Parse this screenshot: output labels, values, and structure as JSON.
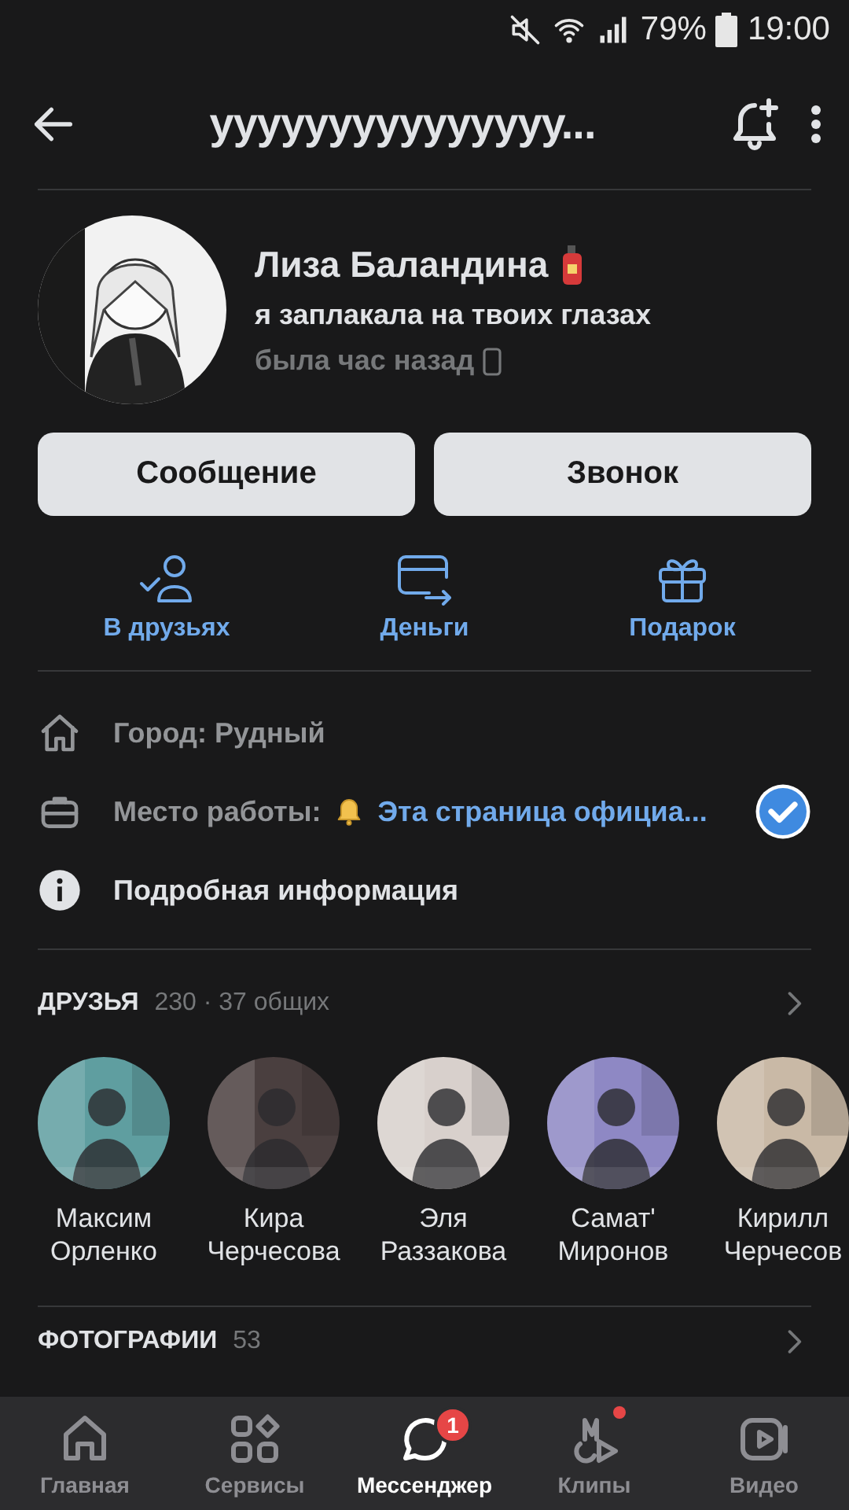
{
  "status_bar": {
    "battery": "79%",
    "time": "19:00"
  },
  "header": {
    "title": "ууууууууууууууу..."
  },
  "profile": {
    "name": "Лиза Баландина",
    "status": "я заплакала на твоих глазах",
    "last_seen": "была час назад"
  },
  "buttons": [
    "Сообщение",
    "Звонок"
  ],
  "actions": [
    {
      "kind": "friend",
      "label": "В друзьях"
    },
    {
      "kind": "money",
      "label": "Деньги"
    },
    {
      "kind": "gift",
      "label": "Подарок"
    }
  ],
  "info": [
    {
      "kind": "city",
      "text": "Город: Рудный"
    },
    {
      "kind": "work",
      "text": "Место работы:",
      "link": "Эта страница официа...",
      "verified": true
    },
    {
      "kind": "details",
      "text": "Подробная информация"
    }
  ],
  "friends": {
    "title": "ДРУЗЬЯ",
    "count": "230 · 37 общих",
    "items": [
      {
        "first": "Максим",
        "last": "Орленко"
      },
      {
        "first": "Кира",
        "last": "Черчесова"
      },
      {
        "first": "Эля",
        "last": "Раззакова"
      },
      {
        "first": "Самат'",
        "last": "Миронов"
      },
      {
        "first": "Кирилл",
        "last": "Черчесов"
      }
    ]
  },
  "photos": {
    "title": "ФОТОГРАФИИ",
    "count": "53"
  },
  "nav": [
    {
      "label": "Главная",
      "selected": false
    },
    {
      "label": "Сервисы",
      "selected": false
    },
    {
      "label": "Мессенджер",
      "selected": true,
      "badge": "1"
    },
    {
      "label": "Клипы",
      "selected": false,
      "dot": true
    },
    {
      "label": "Видео",
      "selected": false
    }
  ]
}
